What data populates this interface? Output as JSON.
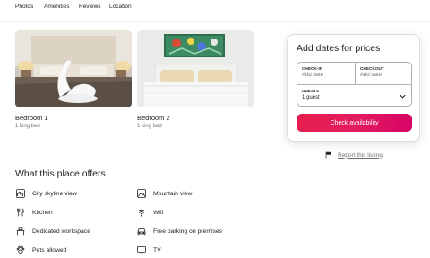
{
  "nav": {
    "items": [
      {
        "label": "Photos"
      },
      {
        "label": "Amenities"
      },
      {
        "label": "Reviews"
      },
      {
        "label": "Location"
      }
    ]
  },
  "bedrooms": [
    {
      "title": "Bedroom 1",
      "beds": "1 king bed"
    },
    {
      "title": "Bedroom 2",
      "beds": "1 king bed"
    }
  ],
  "offers": {
    "title": "What this place offers",
    "items": [
      {
        "label": "City skyline view",
        "icon": "skyline-icon"
      },
      {
        "label": "Mountain view",
        "icon": "mountain-icon"
      },
      {
        "label": "Kitchen",
        "icon": "utensils-icon"
      },
      {
        "label": "Wifi",
        "icon": "wifi-icon"
      },
      {
        "label": "Dedicated workspace",
        "icon": "workspace-icon"
      },
      {
        "label": "Free parking on premises",
        "icon": "car-icon"
      },
      {
        "label": "Pets allowed",
        "icon": "paw-icon"
      },
      {
        "label": "TV",
        "icon": "tv-icon"
      }
    ]
  },
  "booking": {
    "title": "Add dates for prices",
    "checkin_label": "CHECK-IN",
    "checkin_value": "Add date",
    "checkout_label": "CHECKOUT",
    "checkout_value": "Add date",
    "guests_label": "GUESTS",
    "guests_value": "1 guest",
    "cta_label": "Check availability",
    "cta_color": "#e31c5f"
  },
  "report": {
    "label": "Report this listing"
  }
}
